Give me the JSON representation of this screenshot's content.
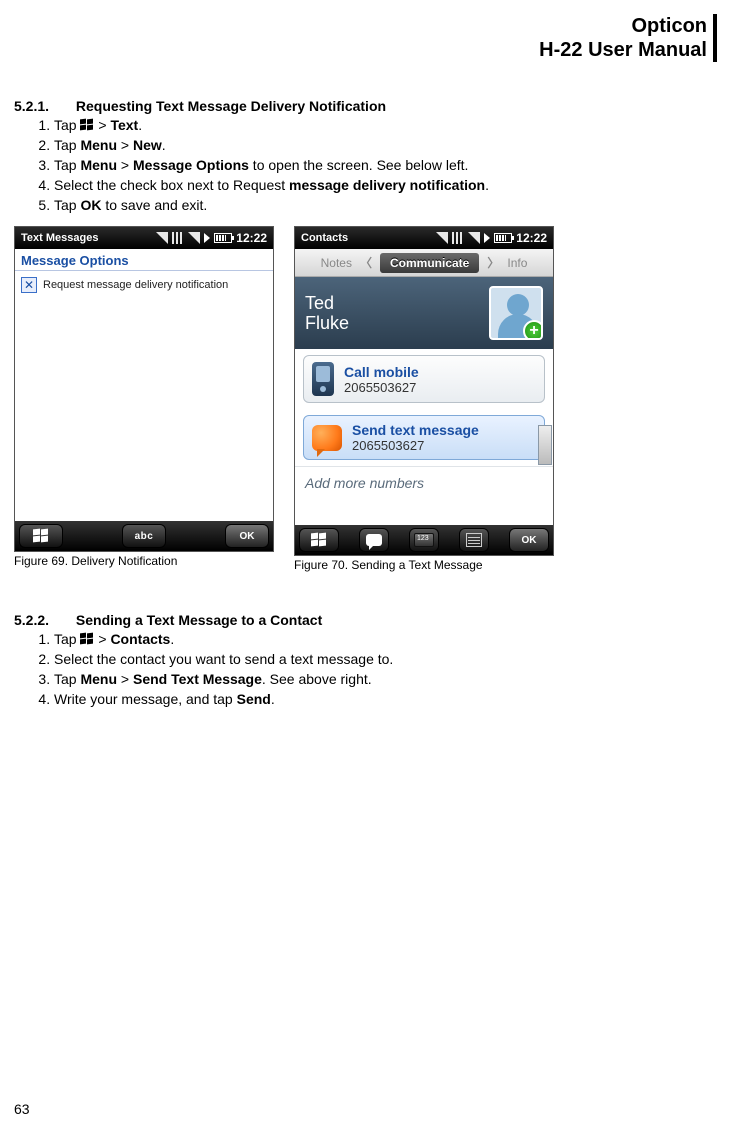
{
  "header": {
    "line1": "Opticon",
    "line2": "H-22 User Manual"
  },
  "section1": {
    "num": "5.2.1.",
    "title": "Requesting Text Message Delivery Notification",
    "steps": {
      "s1a": "Tap ",
      "s1b": " > ",
      "s1c": "Text",
      "s1d": ".",
      "s2a": "Tap ",
      "s2b": "Menu",
      "s2c": " > ",
      "s2d": "New",
      "s2e": ".",
      "s3a": "Tap ",
      "s3b": "Menu",
      "s3c": " > ",
      "s3d": "Message Options",
      "s3e": " to open the screen. See below left.",
      "s4a": "Select the check box next to Request ",
      "s4b": "message delivery notification",
      "s4c": ".",
      "s5a": "Tap ",
      "s5b": "OK",
      "s5c": " to save and exit."
    }
  },
  "fig69": {
    "status_title": "Text Messages",
    "time": "12:22",
    "mo_title": "Message Options",
    "checkbox_label": "Request message delivery notification",
    "abc": "abc",
    "ok": "OK",
    "caption": "Figure 69. Delivery Notification"
  },
  "fig70": {
    "status_title": "Contacts",
    "time": "12:22",
    "tab_left": "Notes",
    "tab_mid": "Communicate",
    "tab_right": "Info",
    "contact_first": "Ted",
    "contact_last": "Fluke",
    "card1_title": "Call mobile",
    "card1_sub": "2065503627",
    "card2_title": "Send text message",
    "card2_sub": "2065503627",
    "add_more": "Add more numbers",
    "ok": "OK",
    "caption": "Figure 70. Sending a Text Message"
  },
  "section2": {
    "num": "5.2.2.",
    "title": "Sending a Text Message to a Contact",
    "steps": {
      "s1a": "Tap ",
      "s1b": " > ",
      "s1c": "Contacts",
      "s1d": ".",
      "s2": "Select the contact you want to send a text message to.",
      "s3a": "Tap ",
      "s3b": "Menu",
      "s3c": " > ",
      "s3d": "Send Text Message",
      "s3e": ".  See above right.",
      "s4a": "Write your message, and tap ",
      "s4b": "Send",
      "s4c": "."
    }
  },
  "page_number": "63"
}
